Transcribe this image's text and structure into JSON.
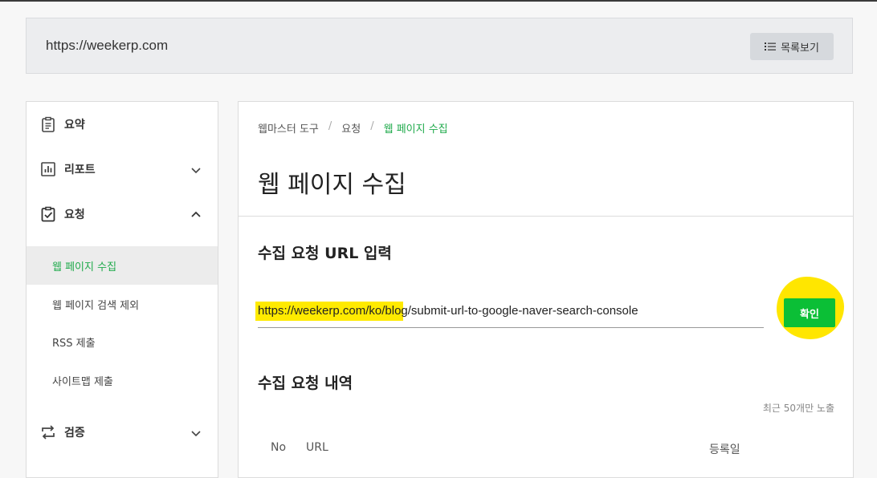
{
  "site": {
    "url": "https://weekerp.com",
    "list_button_label": "목록보기"
  },
  "sidebar": {
    "items": [
      {
        "label": "요약",
        "icon": "clipboard-icon"
      },
      {
        "label": "리포트",
        "icon": "bar-chart-icon",
        "expanded": false
      },
      {
        "label": "요청",
        "icon": "clipboard-check-icon",
        "expanded": true
      },
      {
        "label": "검증",
        "icon": "swap-arrows-icon",
        "expanded": false
      }
    ],
    "sub_items": [
      {
        "label": "웹 페이지 수집",
        "active": true
      },
      {
        "label": "웹 페이지 검색 제외",
        "active": false
      },
      {
        "label": "RSS 제출",
        "active": false
      },
      {
        "label": "사이트맵 제출",
        "active": false
      }
    ]
  },
  "main": {
    "breadcrumb": [
      "웹마스터 도구",
      "요청",
      "웹 페이지 수집"
    ],
    "breadcrumb_separator": "/",
    "page_title": "웹 페이지 수집",
    "url_section_title": "수집 요청 URL 입력",
    "url_input_value": "https://weekerp.com/ko/blog/submit-url-to-google-naver-search-console",
    "confirm_button_label": "확인",
    "history_section_title": "수집 요청 내역",
    "history_note": "최근 50개만 노출",
    "table_headers": [
      "No",
      "URL",
      "등록일"
    ]
  },
  "colors": {
    "accent_green": "#1faa4b",
    "button_green": "#0bbf36",
    "highlight_yellow": "#ffea00"
  }
}
